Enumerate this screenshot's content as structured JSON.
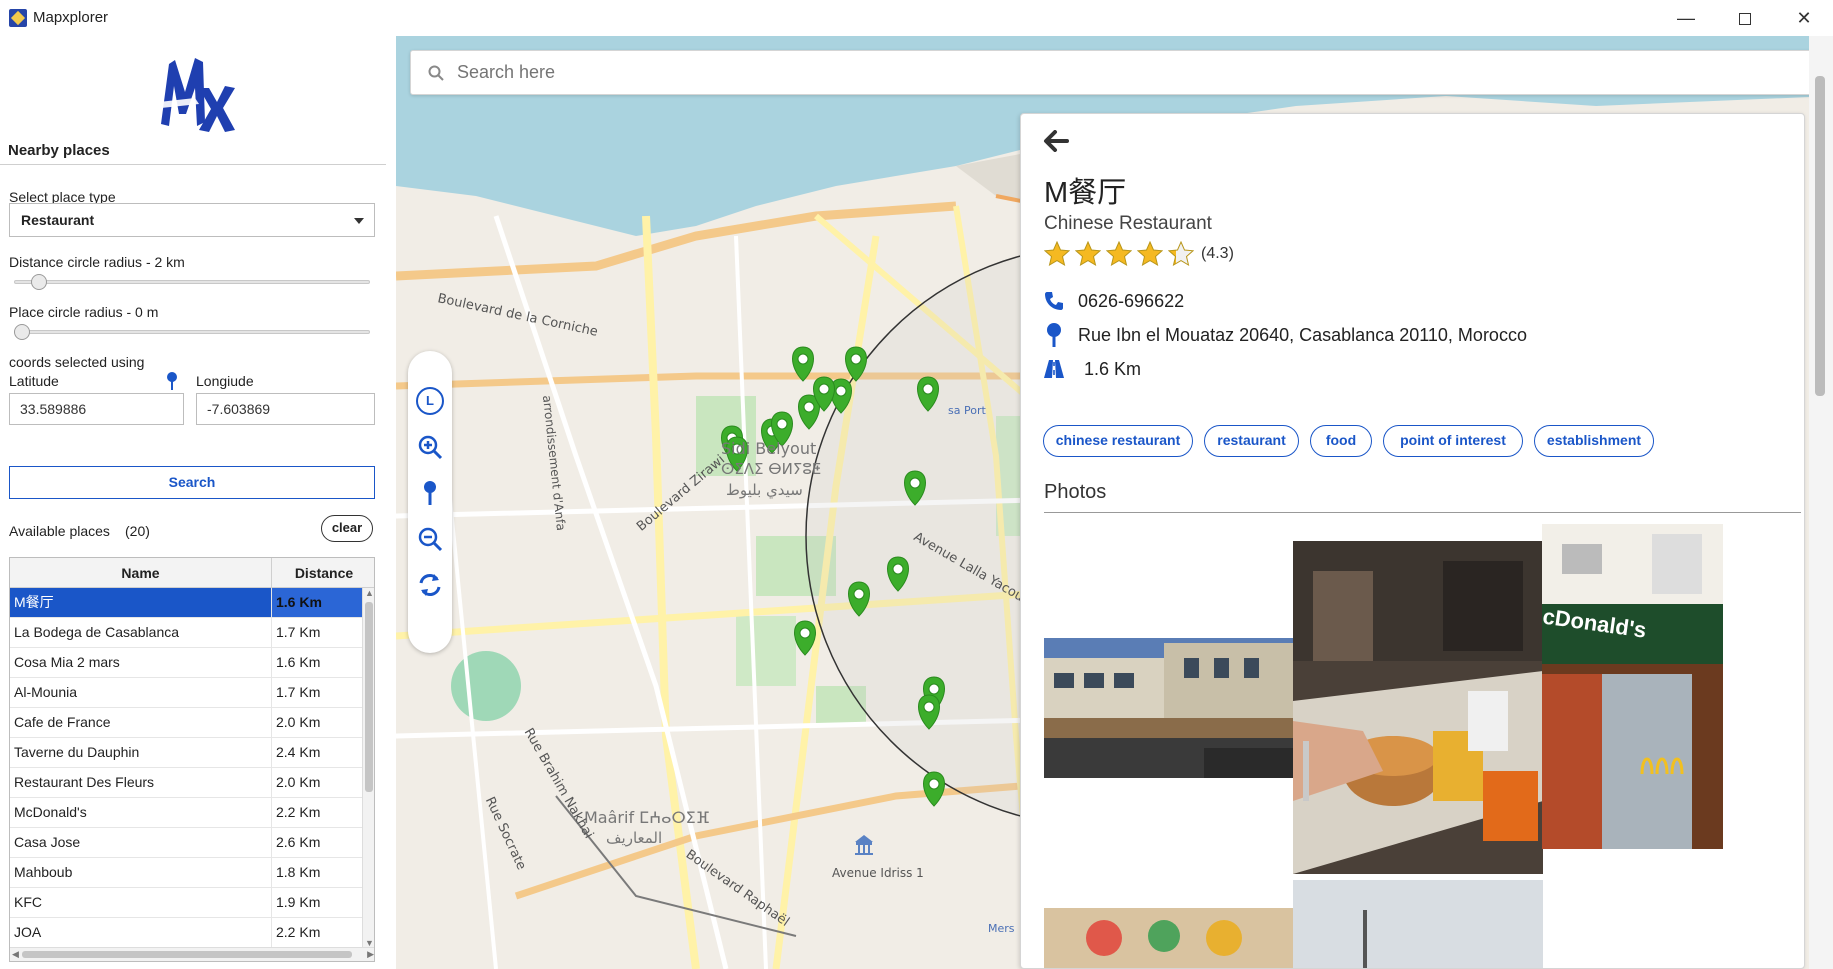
{
  "window": {
    "title": "Mapxplorer",
    "minimize": "—",
    "close": "✕"
  },
  "sidebar": {
    "section_title": "Nearby places",
    "place_type_label": "Select place type",
    "place_type_value": "Restaurant",
    "distance_radius_label": "Distance circle radius - 2 km",
    "distance_radius_fraction": 0.05,
    "place_radius_label": "Place circle radius - 0 m",
    "place_radius_fraction": 0.0,
    "coords_label": "coords selected using",
    "latitude_label": "Latitude",
    "longitude_label": "Longiude",
    "latitude_value": "33.589886",
    "longitude_value": "-7.603869",
    "search_button": "Search",
    "available_label": "Available places",
    "available_count": "(20)",
    "clear_button": "clear",
    "table": {
      "headers": [
        "Name",
        "Distance"
      ],
      "selected_index": 0,
      "rows": [
        [
          "M餐厅",
          "1.6 Km"
        ],
        [
          "La Bodega de Casablanca",
          "1.7 Km"
        ],
        [
          "Cosa Mia 2 mars",
          "1.6 Km"
        ],
        [
          "Al-Mounia",
          "1.7 Km"
        ],
        [
          "Cafe de France",
          "2.0 Km"
        ],
        [
          "Taverne du Dauphin",
          "2.4 Km"
        ],
        [
          "Restaurant Des Fleurs",
          "2.0 Km"
        ],
        [
          "McDonald's",
          "2.2 Km"
        ],
        [
          "Casa Jose",
          "2.6 Km"
        ],
        [
          "Mahboub",
          "1.8 Km"
        ],
        [
          "KFC",
          "1.9 Km"
        ],
        [
          "JOA",
          "2.2 Km"
        ]
      ]
    }
  },
  "map": {
    "search_placeholder": "Search here",
    "toolbar": {
      "locate_label": "L"
    },
    "labels": {
      "corniche": "Boulevard de la Corniche",
      "sidi_belyout": "Sidi Belyout",
      "sidi_belyout_tifinagh": "ⵙⵉⴷⵉ ⴱⵍⵢⵓⵟ",
      "sidi_belyout_arabic": "سيدي بليوط",
      "maarif": "Maârif ⵎⵄⴰⵔⵉⴼ",
      "maarif_arabic": "المعاريف",
      "zirawi": "Boulevard Zirawi",
      "lalla_yacout": "Avenue Lalla Yacout",
      "idriss": "Avenue Idriss 1",
      "rafai": "Boulevard Raphaël",
      "nakhai": "Rue Brahim Nakhai",
      "socrate": "Rue Socrate",
      "port": "sa Port",
      "mers": "Mers",
      "antifa": "arrondissement d'Anfa"
    },
    "pin_color": "#3cad2b",
    "water_color": "#aad3df"
  },
  "detail": {
    "name": "M餐厅",
    "category": "Chinese Restaurant",
    "rating": 4.3,
    "rating_text": "(4.3)",
    "phone": "0626-696622",
    "address": "Rue Ibn el Mouataz 20640, Casablanca 20110, Morocco",
    "distance": "1.6 Km",
    "tags": [
      "chinese restaurant",
      "restaurant",
      "food",
      "point of interest",
      "establishment"
    ],
    "photos_title": "Photos",
    "photo_sign_text": "cDonald's",
    "accent_color": "#1a56c8"
  }
}
